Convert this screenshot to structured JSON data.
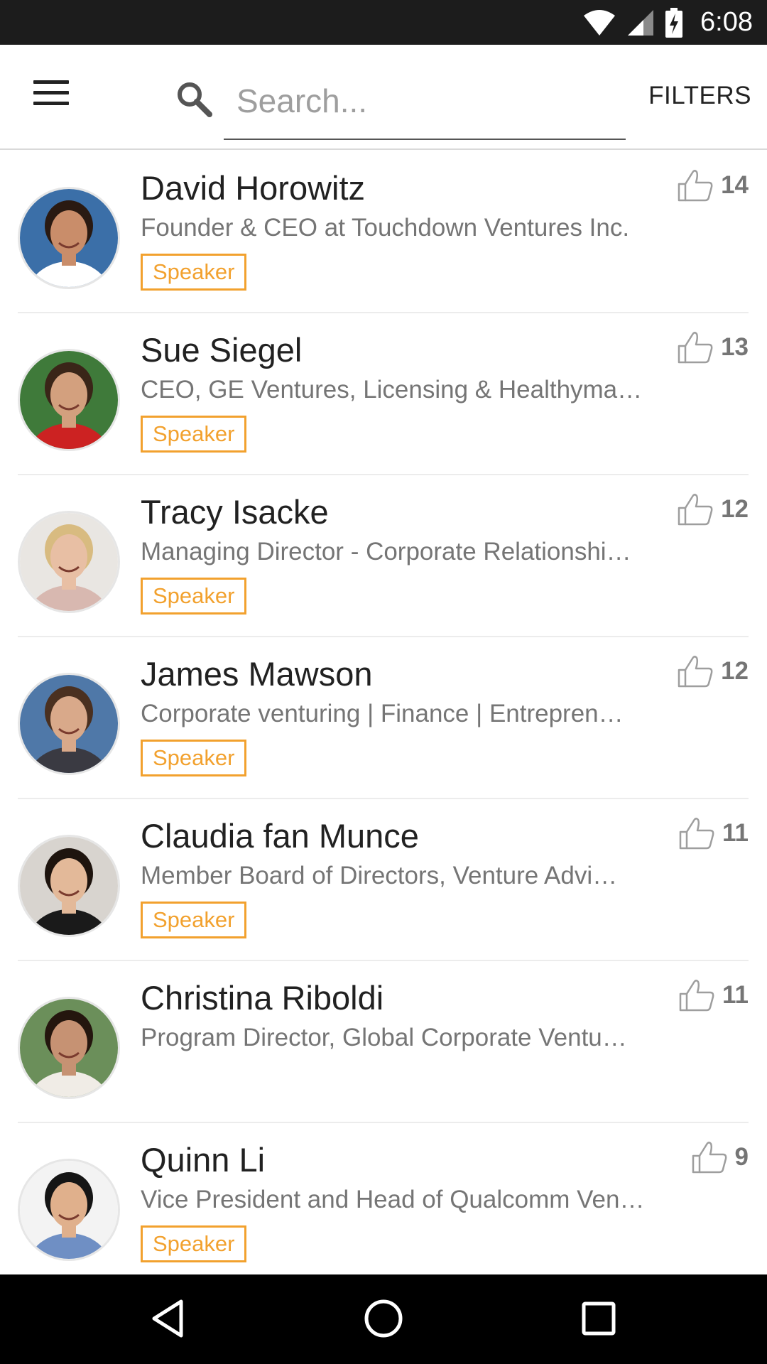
{
  "status_bar": {
    "time": "6:08"
  },
  "header": {
    "search_placeholder": "Search...",
    "filters_label": "FILTERS"
  },
  "speakers": [
    {
      "name": "David Horowitz",
      "title": "Founder & CEO at Touchdown Ventures Inc.",
      "badge": "Speaker",
      "likes": "14",
      "avatar_bg": "#3b6fa8",
      "avatar_skin": "#c98d6a",
      "avatar_hair": "#2a1a12",
      "avatar_shirt": "#ffffff"
    },
    {
      "name": "Sue Siegel",
      "title": "CEO, GE Ventures, Licensing & Healthyma…",
      "badge": "Speaker",
      "likes": "13",
      "avatar_bg": "#3f7a3a",
      "avatar_skin": "#d3a07e",
      "avatar_hair": "#3a2518",
      "avatar_shirt": "#cc2222"
    },
    {
      "name": "Tracy Isacke",
      "title": "Managing Director - Corporate Relationshi…",
      "badge": "Speaker",
      "likes": "12",
      "avatar_bg": "#e9e6e2",
      "avatar_skin": "#e8bfa4",
      "avatar_hair": "#d8bb80",
      "avatar_shirt": "#d8b8b0"
    },
    {
      "name": "James Mawson",
      "title": "Corporate venturing | Finance | Entrepren…",
      "badge": "Speaker",
      "likes": "12",
      "avatar_bg": "#4f78a8",
      "avatar_skin": "#d9a98a",
      "avatar_hair": "#4a3020",
      "avatar_shirt": "#3a3a42"
    },
    {
      "name": "Claudia fan Munce",
      "title": "Member Board of Directors, Venture Advi…",
      "badge": "Speaker",
      "likes": "11",
      "avatar_bg": "#d8d4cf",
      "avatar_skin": "#e3b999",
      "avatar_hair": "#1e140e",
      "avatar_shirt": "#1a1a1a"
    },
    {
      "name": "Christina Riboldi",
      "title": "Program Director, Global Corporate Ventu…",
      "badge": "",
      "likes": "11",
      "avatar_bg": "#6b8f5a",
      "avatar_skin": "#c69273",
      "avatar_hair": "#24160e",
      "avatar_shirt": "#f0ece6"
    },
    {
      "name": "Quinn Li",
      "title": "Vice President and Head of Qualcomm Ven…",
      "badge": "Speaker",
      "likes": "9",
      "avatar_bg": "#f3f3f3",
      "avatar_skin": "#e0b08c",
      "avatar_hair": "#151515",
      "avatar_shirt": "#6f8fc4"
    }
  ],
  "icons": {
    "menu": "menu-icon",
    "search": "search-icon",
    "like": "thumbs-up-icon",
    "back": "back-triangle-icon",
    "home": "home-circle-icon",
    "recents": "recents-square-icon"
  },
  "colors": {
    "badge": "#f2a12e",
    "status_bar": "#1c1c1c",
    "nav_bar": "#000000"
  }
}
